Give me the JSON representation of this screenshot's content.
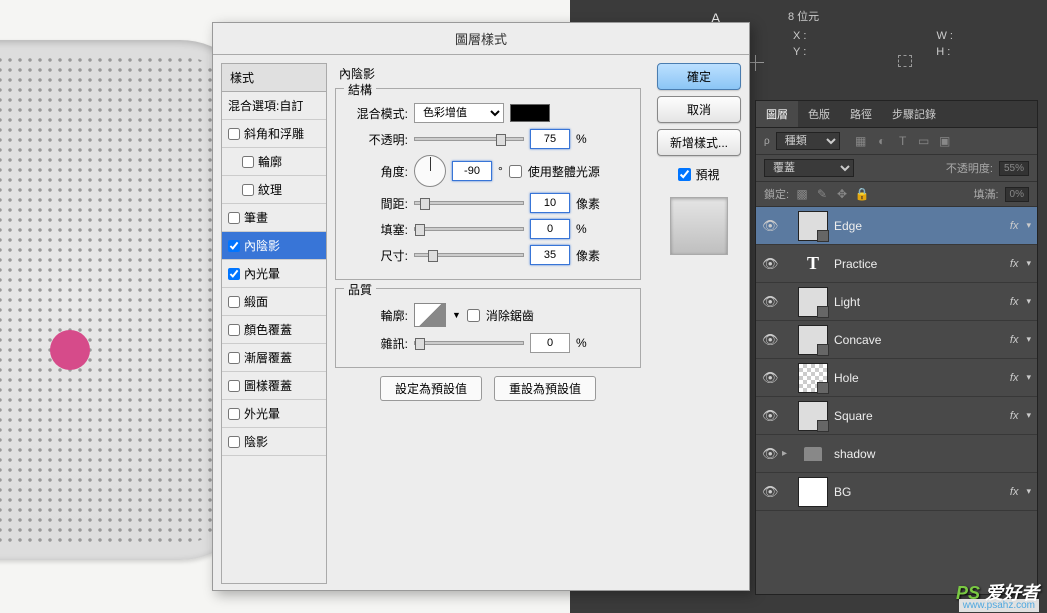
{
  "info": {
    "char": "A",
    "bits": "8 位元",
    "x_label": "X :",
    "y_label": "Y :",
    "w_label": "W :",
    "h_label": "H :"
  },
  "dialog": {
    "title": "圖層樣式",
    "styles_header": "樣式",
    "blend_options": "混合選項:自訂",
    "items": [
      {
        "label": "斜角和浮雕",
        "checked": false
      },
      {
        "label": "輪廓",
        "checked": false,
        "indent": true
      },
      {
        "label": "紋理",
        "checked": false,
        "indent": true
      },
      {
        "label": "筆畫",
        "checked": false
      },
      {
        "label": "內陰影",
        "checked": true,
        "selected": true
      },
      {
        "label": "內光暈",
        "checked": true
      },
      {
        "label": "緞面",
        "checked": false
      },
      {
        "label": "顏色覆蓋",
        "checked": false
      },
      {
        "label": "漸層覆蓋",
        "checked": false
      },
      {
        "label": "圖樣覆蓋",
        "checked": false
      },
      {
        "label": "外光暈",
        "checked": false
      },
      {
        "label": "陰影",
        "checked": false
      }
    ],
    "section_title": "內陰影",
    "structure": "結構",
    "blend_mode_label": "混合模式:",
    "blend_mode_value": "色彩增值",
    "opacity_label": "不透明:",
    "opacity_value": "75",
    "angle_label": "角度:",
    "angle_value": "-90",
    "degree": "°",
    "global_light": "使用整體光源",
    "distance_label": "間距:",
    "distance_value": "10",
    "choke_label": "填塞:",
    "choke_value": "0",
    "size_label": "尺寸:",
    "size_value": "35",
    "px": "像素",
    "pct": "%",
    "quality": "品質",
    "contour_label": "輪廓:",
    "antialias": "消除鋸齒",
    "noise_label": "雜訊:",
    "noise_value": "0",
    "make_default": "設定為預設值",
    "reset_default": "重設為預設值",
    "ok": "確定",
    "cancel": "取消",
    "new_style": "新增樣式...",
    "preview": "預視"
  },
  "panels": {
    "tabs": [
      "圖層",
      "色版",
      "路徑",
      "步驟記錄"
    ],
    "kind_label": "種類",
    "mode": "覆蓋",
    "opacity_label": "不透明度:",
    "opacity_value": "55%",
    "lock_label": "鎖定:",
    "fill_label": "填滿:",
    "fill_value": "0%",
    "layers": [
      {
        "name": "Edge",
        "fx": true,
        "selected": true,
        "thumb": "shape"
      },
      {
        "name": "Practice",
        "fx": true,
        "thumb": "text"
      },
      {
        "name": "Light",
        "fx": true,
        "thumb": "shape"
      },
      {
        "name": "Concave",
        "fx": true,
        "thumb": "shape"
      },
      {
        "name": "Hole",
        "fx": true,
        "thumb": "shape"
      },
      {
        "name": "Square",
        "fx": true,
        "thumb": "shape"
      },
      {
        "name": "shadow",
        "fx": false,
        "thumb": "folder"
      },
      {
        "name": "BG",
        "fx": true,
        "thumb": "plain"
      }
    ]
  },
  "watermark": {
    "brand_prefix": "PS",
    "brand_suffix": " 爱好者",
    "url": "www.psahz.com"
  }
}
